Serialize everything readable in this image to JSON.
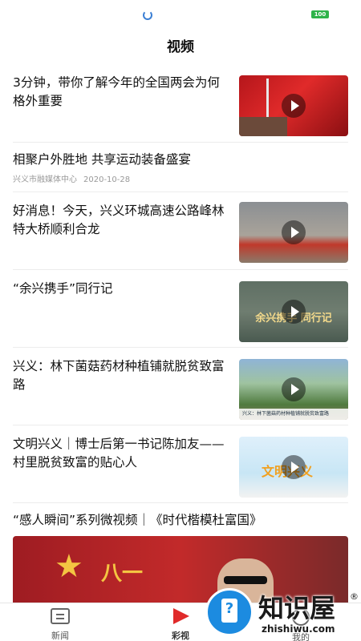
{
  "status": {
    "battery": "100"
  },
  "page_title": "视频",
  "feed": [
    {
      "headline": "3分钟，带你了解今年的全国两会为何格外重要",
      "has_thumb": true
    },
    {
      "headline": "相聚户外胜地 共享运动装备盛宴",
      "source": "兴义市融媒体中心",
      "date": "2020-10-28",
      "has_thumb": false
    },
    {
      "headline": "好消息！今天，兴义环城高速公路峰林特大桥顺利合龙",
      "has_thumb": true
    },
    {
      "headline": "“余兴携手”同行记",
      "has_thumb": true,
      "thumb_caption": "余兴携手 同行记"
    },
    {
      "headline": "兴义：林下菌菇药材种植铺就脱贫致富路",
      "has_thumb": true,
      "thumb_caption": "兴义：林下菌菇药材种植铺就脱贫致富路"
    },
    {
      "headline": "文明兴义｜博士后第一书记陈加友——村里脱贫致富的贴心人",
      "has_thumb": true,
      "thumb_caption": "文明兴义"
    }
  ],
  "featured": {
    "headline": "“感人瞬间”系列微视频｜《时代楷模杜富国》",
    "video_caption": "八一"
  },
  "tabbar": {
    "news": "新闻",
    "video": "彩视",
    "mine": "我的"
  },
  "watermark": {
    "text": "知识屋",
    "url": "zhishiwu.com",
    "reg": "®"
  }
}
